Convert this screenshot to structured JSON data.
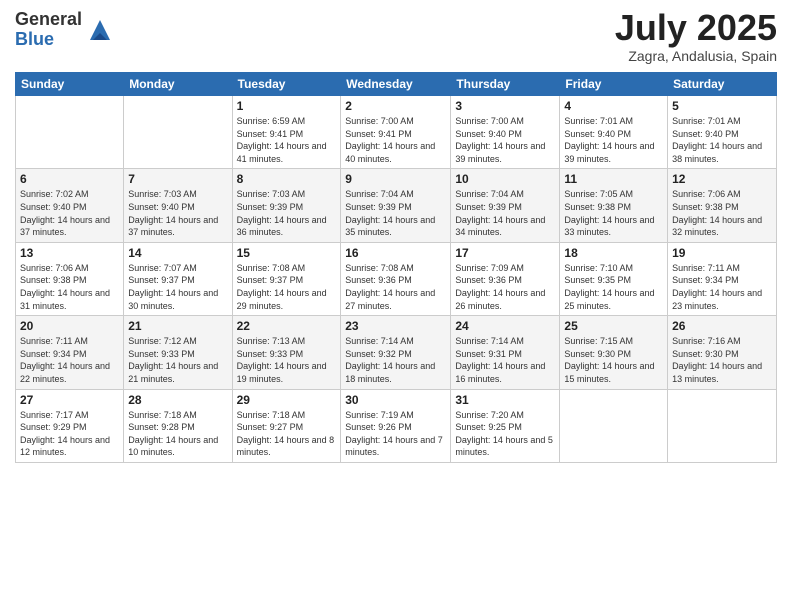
{
  "logo": {
    "general": "General",
    "blue": "Blue"
  },
  "header": {
    "month": "July 2025",
    "location": "Zagra, Andalusia, Spain"
  },
  "weekdays": [
    "Sunday",
    "Monday",
    "Tuesday",
    "Wednesday",
    "Thursday",
    "Friday",
    "Saturday"
  ],
  "weeks": [
    [
      {
        "day": "",
        "sunrise": "",
        "sunset": "",
        "daylight": ""
      },
      {
        "day": "",
        "sunrise": "",
        "sunset": "",
        "daylight": ""
      },
      {
        "day": "1",
        "sunrise": "Sunrise: 6:59 AM",
        "sunset": "Sunset: 9:41 PM",
        "daylight": "Daylight: 14 hours and 41 minutes."
      },
      {
        "day": "2",
        "sunrise": "Sunrise: 7:00 AM",
        "sunset": "Sunset: 9:41 PM",
        "daylight": "Daylight: 14 hours and 40 minutes."
      },
      {
        "day": "3",
        "sunrise": "Sunrise: 7:00 AM",
        "sunset": "Sunset: 9:40 PM",
        "daylight": "Daylight: 14 hours and 39 minutes."
      },
      {
        "day": "4",
        "sunrise": "Sunrise: 7:01 AM",
        "sunset": "Sunset: 9:40 PM",
        "daylight": "Daylight: 14 hours and 39 minutes."
      },
      {
        "day": "5",
        "sunrise": "Sunrise: 7:01 AM",
        "sunset": "Sunset: 9:40 PM",
        "daylight": "Daylight: 14 hours and 38 minutes."
      }
    ],
    [
      {
        "day": "6",
        "sunrise": "Sunrise: 7:02 AM",
        "sunset": "Sunset: 9:40 PM",
        "daylight": "Daylight: 14 hours and 37 minutes."
      },
      {
        "day": "7",
        "sunrise": "Sunrise: 7:03 AM",
        "sunset": "Sunset: 9:40 PM",
        "daylight": "Daylight: 14 hours and 37 minutes."
      },
      {
        "day": "8",
        "sunrise": "Sunrise: 7:03 AM",
        "sunset": "Sunset: 9:39 PM",
        "daylight": "Daylight: 14 hours and 36 minutes."
      },
      {
        "day": "9",
        "sunrise": "Sunrise: 7:04 AM",
        "sunset": "Sunset: 9:39 PM",
        "daylight": "Daylight: 14 hours and 35 minutes."
      },
      {
        "day": "10",
        "sunrise": "Sunrise: 7:04 AM",
        "sunset": "Sunset: 9:39 PM",
        "daylight": "Daylight: 14 hours and 34 minutes."
      },
      {
        "day": "11",
        "sunrise": "Sunrise: 7:05 AM",
        "sunset": "Sunset: 9:38 PM",
        "daylight": "Daylight: 14 hours and 33 minutes."
      },
      {
        "day": "12",
        "sunrise": "Sunrise: 7:06 AM",
        "sunset": "Sunset: 9:38 PM",
        "daylight": "Daylight: 14 hours and 32 minutes."
      }
    ],
    [
      {
        "day": "13",
        "sunrise": "Sunrise: 7:06 AM",
        "sunset": "Sunset: 9:38 PM",
        "daylight": "Daylight: 14 hours and 31 minutes."
      },
      {
        "day": "14",
        "sunrise": "Sunrise: 7:07 AM",
        "sunset": "Sunset: 9:37 PM",
        "daylight": "Daylight: 14 hours and 30 minutes."
      },
      {
        "day": "15",
        "sunrise": "Sunrise: 7:08 AM",
        "sunset": "Sunset: 9:37 PM",
        "daylight": "Daylight: 14 hours and 29 minutes."
      },
      {
        "day": "16",
        "sunrise": "Sunrise: 7:08 AM",
        "sunset": "Sunset: 9:36 PM",
        "daylight": "Daylight: 14 hours and 27 minutes."
      },
      {
        "day": "17",
        "sunrise": "Sunrise: 7:09 AM",
        "sunset": "Sunset: 9:36 PM",
        "daylight": "Daylight: 14 hours and 26 minutes."
      },
      {
        "day": "18",
        "sunrise": "Sunrise: 7:10 AM",
        "sunset": "Sunset: 9:35 PM",
        "daylight": "Daylight: 14 hours and 25 minutes."
      },
      {
        "day": "19",
        "sunrise": "Sunrise: 7:11 AM",
        "sunset": "Sunset: 9:34 PM",
        "daylight": "Daylight: 14 hours and 23 minutes."
      }
    ],
    [
      {
        "day": "20",
        "sunrise": "Sunrise: 7:11 AM",
        "sunset": "Sunset: 9:34 PM",
        "daylight": "Daylight: 14 hours and 22 minutes."
      },
      {
        "day": "21",
        "sunrise": "Sunrise: 7:12 AM",
        "sunset": "Sunset: 9:33 PM",
        "daylight": "Daylight: 14 hours and 21 minutes."
      },
      {
        "day": "22",
        "sunrise": "Sunrise: 7:13 AM",
        "sunset": "Sunset: 9:33 PM",
        "daylight": "Daylight: 14 hours and 19 minutes."
      },
      {
        "day": "23",
        "sunrise": "Sunrise: 7:14 AM",
        "sunset": "Sunset: 9:32 PM",
        "daylight": "Daylight: 14 hours and 18 minutes."
      },
      {
        "day": "24",
        "sunrise": "Sunrise: 7:14 AM",
        "sunset": "Sunset: 9:31 PM",
        "daylight": "Daylight: 14 hours and 16 minutes."
      },
      {
        "day": "25",
        "sunrise": "Sunrise: 7:15 AM",
        "sunset": "Sunset: 9:30 PM",
        "daylight": "Daylight: 14 hours and 15 minutes."
      },
      {
        "day": "26",
        "sunrise": "Sunrise: 7:16 AM",
        "sunset": "Sunset: 9:30 PM",
        "daylight": "Daylight: 14 hours and 13 minutes."
      }
    ],
    [
      {
        "day": "27",
        "sunrise": "Sunrise: 7:17 AM",
        "sunset": "Sunset: 9:29 PM",
        "daylight": "Daylight: 14 hours and 12 minutes."
      },
      {
        "day": "28",
        "sunrise": "Sunrise: 7:18 AM",
        "sunset": "Sunset: 9:28 PM",
        "daylight": "Daylight: 14 hours and 10 minutes."
      },
      {
        "day": "29",
        "sunrise": "Sunrise: 7:18 AM",
        "sunset": "Sunset: 9:27 PM",
        "daylight": "Daylight: 14 hours and 8 minutes."
      },
      {
        "day": "30",
        "sunrise": "Sunrise: 7:19 AM",
        "sunset": "Sunset: 9:26 PM",
        "daylight": "Daylight: 14 hours and 7 minutes."
      },
      {
        "day": "31",
        "sunrise": "Sunrise: 7:20 AM",
        "sunset": "Sunset: 9:25 PM",
        "daylight": "Daylight: 14 hours and 5 minutes."
      },
      {
        "day": "",
        "sunrise": "",
        "sunset": "",
        "daylight": ""
      },
      {
        "day": "",
        "sunrise": "",
        "sunset": "",
        "daylight": ""
      }
    ]
  ]
}
